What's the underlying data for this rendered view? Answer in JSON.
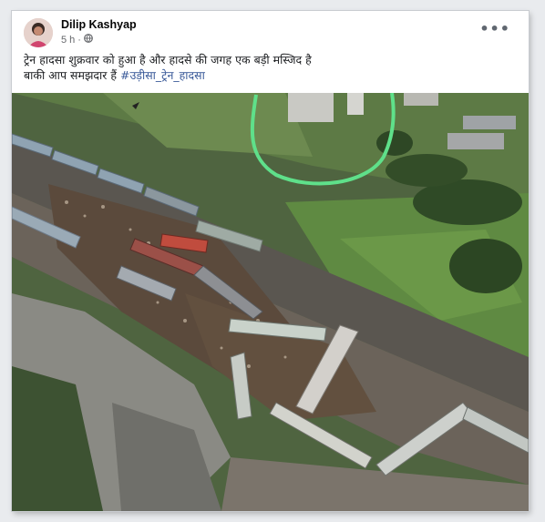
{
  "post": {
    "author": "Dilip Kashyap",
    "time": "5 h",
    "separator": "·",
    "more_label": "•••",
    "text_line1": "ट्रेन हादसा शुक्रवार को हुआ है और हादसे की जगह एक बड़ी मस्जिद है",
    "text_line2": "बाकी आप समझदार हैं ",
    "hashtag": "#उड़ीसा_ट्रेन_हादसा"
  },
  "icons": {
    "privacy": "globe-icon",
    "more": "more-options-icon"
  },
  "colors": {
    "hashtag": "#385898",
    "highlight_circle": "#5fe08a"
  }
}
